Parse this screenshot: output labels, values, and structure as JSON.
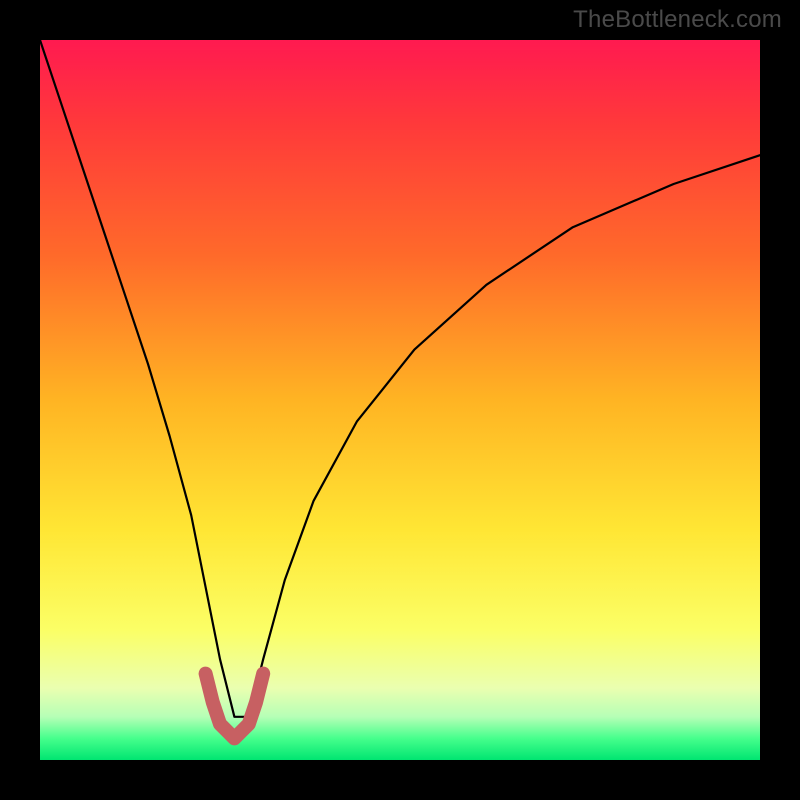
{
  "watermark": "TheBottleneck.com",
  "colors": {
    "frame": "#000000",
    "curve": "#000000",
    "marker": "#c76062",
    "gradient_stops": [
      {
        "offset": 0.0,
        "color": "#ff1a50"
      },
      {
        "offset": 0.12,
        "color": "#ff3a3a"
      },
      {
        "offset": 0.3,
        "color": "#ff6a2a"
      },
      {
        "offset": 0.5,
        "color": "#ffb423"
      },
      {
        "offset": 0.68,
        "color": "#ffe634"
      },
      {
        "offset": 0.82,
        "color": "#fbff66"
      },
      {
        "offset": 0.9,
        "color": "#eaffb0"
      },
      {
        "offset": 0.94,
        "color": "#b6ffb6"
      },
      {
        "offset": 0.97,
        "color": "#46ff8c"
      },
      {
        "offset": 1.0,
        "color": "#00e571"
      }
    ]
  },
  "chart_data": {
    "type": "line",
    "title": "",
    "xlabel": "",
    "ylabel": "",
    "xlim": [
      0,
      100
    ],
    "ylim": [
      0,
      100
    ],
    "note": "Bottleneck curve. x roughly represents relative component strength (approx 0–100%); y is bottleneck percentage (0 at bottom, 100 at top). Minimum near x≈27 where the highlighted marker sits.",
    "series": [
      {
        "name": "bottleneck-curve",
        "x": [
          0,
          3,
          6,
          9,
          12,
          15,
          18,
          21,
          23,
          25,
          27,
          29,
          31,
          34,
          38,
          44,
          52,
          62,
          74,
          88,
          100
        ],
        "y": [
          100,
          91,
          82,
          73,
          64,
          55,
          45,
          34,
          24,
          14,
          6,
          6,
          14,
          25,
          36,
          47,
          57,
          66,
          74,
          80,
          84
        ]
      },
      {
        "name": "optimal-marker",
        "x": [
          23,
          24,
          25,
          26,
          27,
          28,
          29,
          30,
          31
        ],
        "y": [
          12,
          8,
          5,
          4,
          3,
          4,
          5,
          8,
          12
        ]
      }
    ]
  }
}
